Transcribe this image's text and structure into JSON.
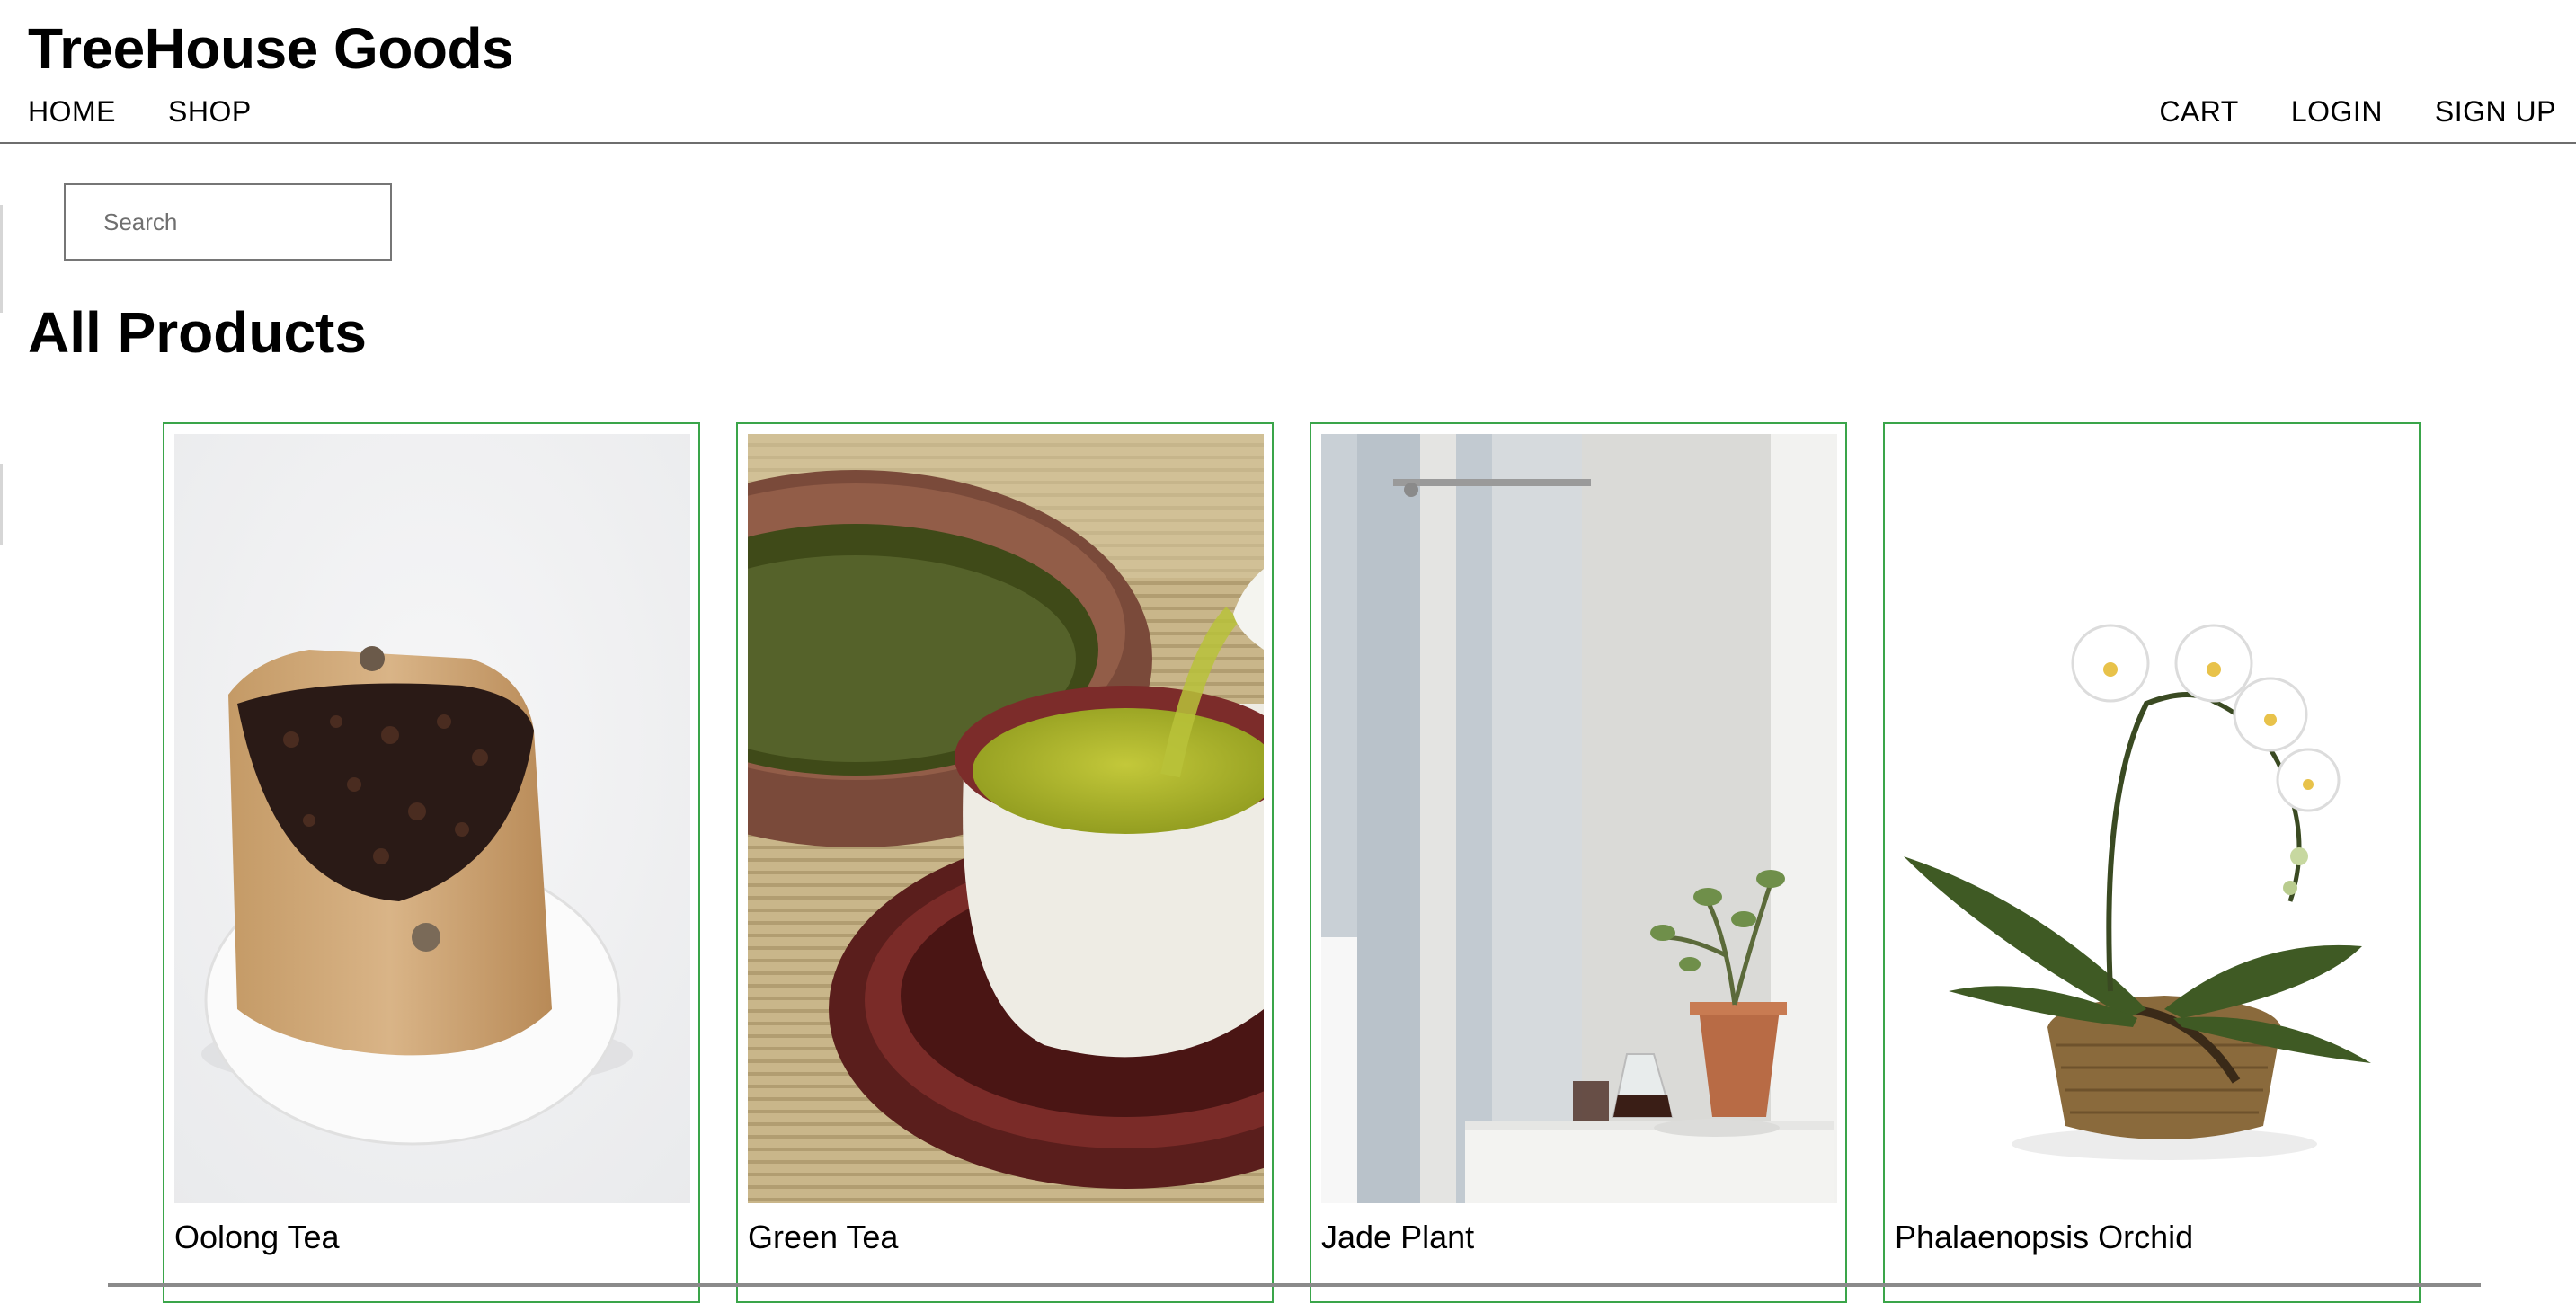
{
  "header": {
    "brand": "TreeHouse Goods",
    "nav_left": [
      "HOME",
      "SHOP"
    ],
    "nav_right": [
      "CART",
      "LOGIN",
      "SIGN UP"
    ]
  },
  "search": {
    "placeholder": "Search",
    "value": ""
  },
  "main": {
    "title": "All Products",
    "products": [
      {
        "name": "Oolong Tea",
        "image": "oolong-tea-bag-image"
      },
      {
        "name": "Green Tea",
        "image": "green-tea-cup-image"
      },
      {
        "name": "Jade Plant",
        "image": "jade-plant-window-image"
      },
      {
        "name": "Phalaenopsis Orchid",
        "image": "white-orchid-basket-image"
      }
    ]
  },
  "colors": {
    "card_border": "#3aa54a",
    "header_rule": "#6e6e6e"
  }
}
